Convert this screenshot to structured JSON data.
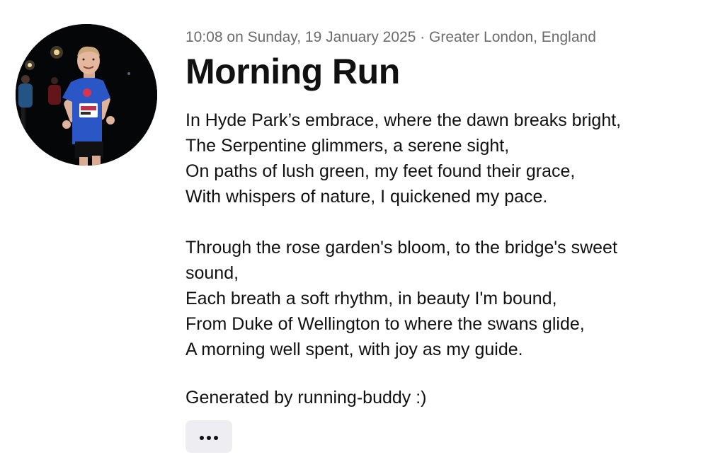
{
  "activity": {
    "meta": "10:08 on Sunday, 19 January 2025 · Greater London, England",
    "title": "Morning Run",
    "poem": {
      "stanza1": [
        "In Hyde Park’s embrace, where the dawn breaks bright,",
        "The Serpentine glimmers, a serene sight,",
        "On paths of lush green, my feet found their grace,",
        "With whispers of nature, I quickened my pace."
      ],
      "stanza2": [
        "Through the rose garden's bloom, to the bridge's sweet sound,",
        "Each breath a soft rhythm, in beauty I'm bound,",
        "From Duke of Wellington to where the swans glide,",
        "A morning well spent, with joy as my guide."
      ]
    },
    "footer": "Generated by running-buddy :)",
    "more_button": {
      "icon": "more-horizontal-icon"
    }
  },
  "colors": {
    "meta_text": "#6b6b6b",
    "body_text": "#111111",
    "button_bg": "#eeeef2",
    "shirt": "#2a56c6"
  }
}
